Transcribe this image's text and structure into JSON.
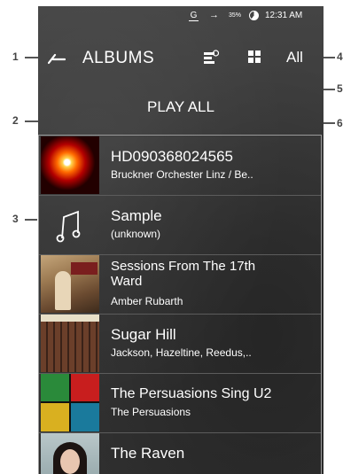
{
  "callouts": [
    "1",
    "2",
    "3",
    "4",
    "5",
    "6"
  ],
  "status_bar": {
    "g_icon": "G",
    "arrow_icon": "→",
    "battery": "35%",
    "time": "12:31 AM"
  },
  "header": {
    "title": "ALBUMS",
    "all_label": "All"
  },
  "play_all_label": "PLAY ALL",
  "albums": [
    {
      "title": "HD090368024565",
      "artist": "Bruckner Orchester Linz / Be..",
      "art": "fireworks"
    },
    {
      "title": "Sample",
      "artist": "(unknown)",
      "art": "music-note"
    },
    {
      "title": "Sessions From The 17th Ward",
      "artist": "Amber Rubarth",
      "art": "guitar-player"
    },
    {
      "title": "Sugar Hill",
      "artist": "Jackson, Hazeltine, Reedus,..",
      "art": "building"
    },
    {
      "title": "The Persuasions Sing U2",
      "artist": "The Persuasions",
      "art": "portraits"
    },
    {
      "title": "The Raven",
      "artist": "",
      "art": "woman-portrait"
    }
  ],
  "colors": {
    "background": "#3c3c3c",
    "text": "#ffffff",
    "callout": "#555555"
  }
}
